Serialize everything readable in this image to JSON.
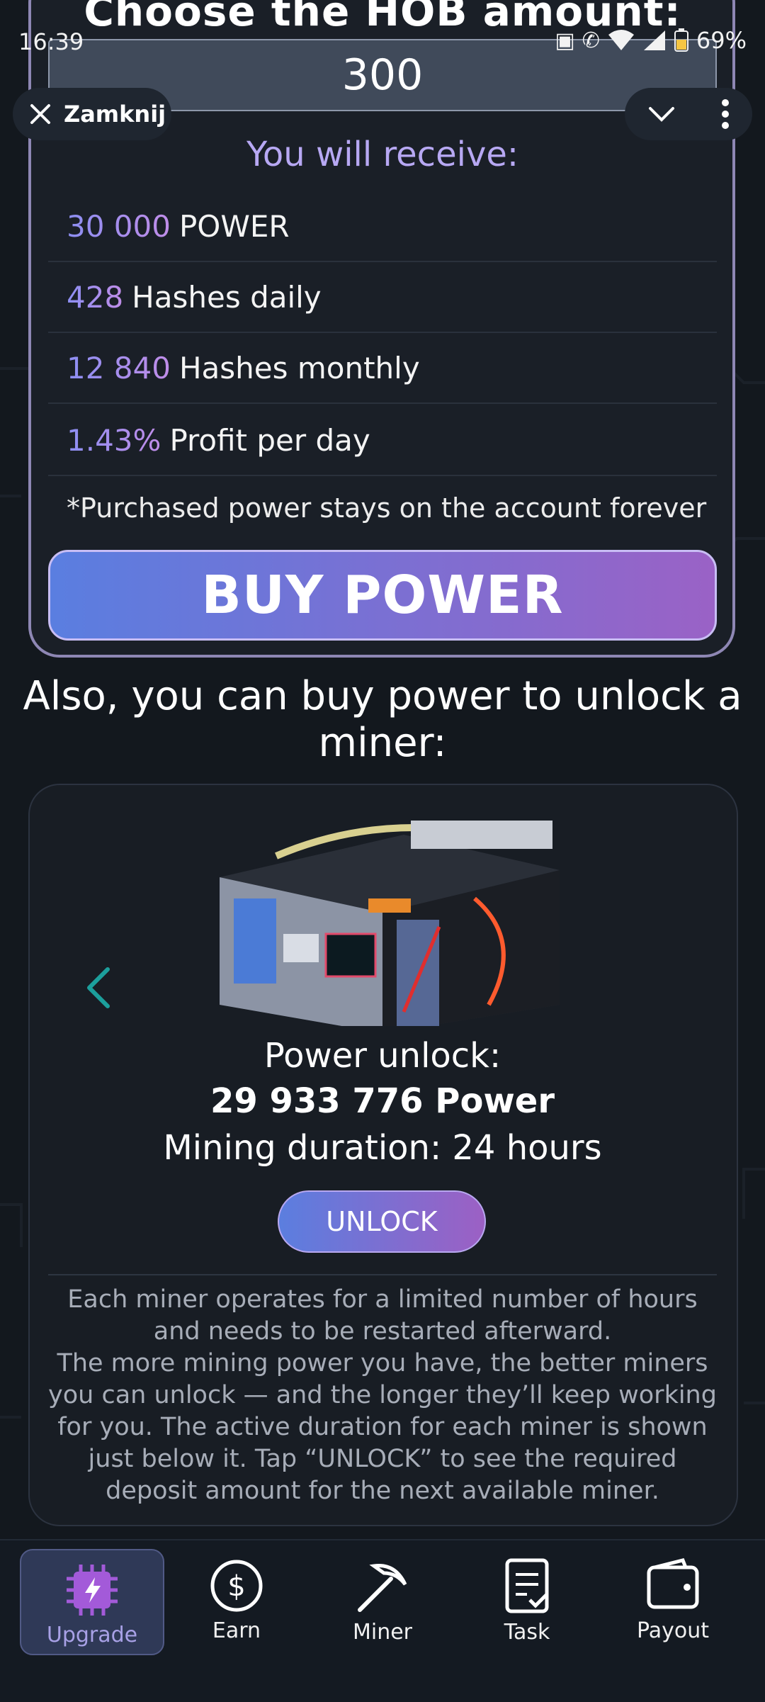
{
  "status_bar": {
    "time": "16:39",
    "battery": "69%"
  },
  "overlay": {
    "close_label": "Zamknij"
  },
  "purchase": {
    "title": "Choose the HOB amount:",
    "amount_value": "300",
    "receive_heading": "You will receive:",
    "rows": [
      {
        "value": "30 000",
        "label": "POWER"
      },
      {
        "value": "428",
        "label": "Hashes daily"
      },
      {
        "value": "12 840",
        "label": "Hashes monthly"
      },
      {
        "value": "1.43%",
        "label": "Profit per day"
      }
    ],
    "note": "*Purchased power stays on the account forever",
    "buy_label": "BUY POWER"
  },
  "unlock_section": {
    "heading": "Also, you can buy power to unlock a miner:",
    "power_unlock_label": "Power unlock:",
    "power_unlock_value": "29 933 776 Power",
    "mining_duration": "Mining duration: 24 hours",
    "unlock_label": "UNLOCK",
    "description": "Each miner operates for a limited number of hours and needs to be restarted afterward.\nThe more mining power you have, the better miners you can unlock — and the longer they’ll keep working for you. The active duration for each miner is shown just below it. Tap “UNLOCK” to see the required deposit amount for the next available miner."
  },
  "nav": {
    "items": [
      {
        "label": "Upgrade",
        "icon": "cpu-bolt-icon",
        "active": true
      },
      {
        "label": "Earn",
        "icon": "dollar-icon",
        "active": false
      },
      {
        "label": "Miner",
        "icon": "pickaxe-icon",
        "active": false
      },
      {
        "label": "Task",
        "icon": "clipboard-check-icon",
        "active": false
      },
      {
        "label": "Payout",
        "icon": "wallet-icon",
        "active": false
      }
    ]
  },
  "colors": {
    "accent_gradient_start": "#5a7ee0",
    "accent_gradient_end": "#9a62c6",
    "highlight_text": "#b7a8f3",
    "background": "#13181e"
  }
}
